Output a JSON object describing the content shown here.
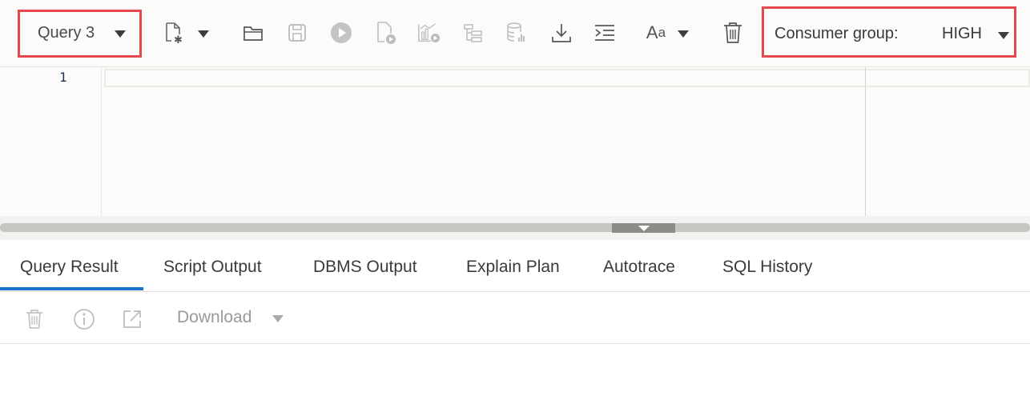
{
  "toolbar": {
    "query_label": "Query 3",
    "icons": [
      "new-file-icon",
      "open-folder-icon",
      "save-icon",
      "run-icon",
      "run-script-icon",
      "chart-run-icon",
      "explain-plan-icon",
      "database-icon",
      "download-icon",
      "format-icon",
      "font-icon",
      "trash-icon"
    ],
    "consumer_group_label": "Consumer group:",
    "consumer_group_value": "HIGH",
    "highlight_color": "#e5484d"
  },
  "editor": {
    "line_numbers": [
      "1"
    ]
  },
  "tabs": [
    {
      "label": "Query Result",
      "active": true
    },
    {
      "label": "Script Output"
    },
    {
      "label": "DBMS Output"
    },
    {
      "label": "Explain Plan"
    },
    {
      "label": "Autotrace"
    },
    {
      "label": "SQL History"
    }
  ],
  "result_toolbar": {
    "icons": [
      "trash-icon",
      "info-icon",
      "external-link-icon"
    ],
    "download_label": "Download"
  },
  "accent_color": "#1a73c8"
}
